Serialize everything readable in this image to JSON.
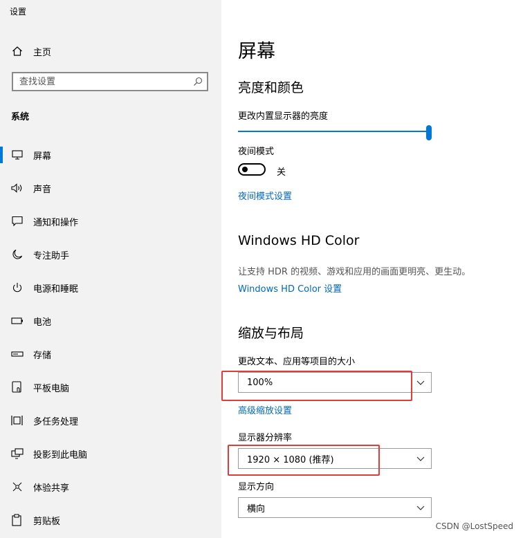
{
  "window": {
    "title": "设置"
  },
  "sidebar": {
    "home_label": "主页",
    "search_placeholder": "查找设置",
    "section_label": "系统",
    "items": [
      {
        "label": "屏幕",
        "icon": "monitor-icon"
      },
      {
        "label": "声音",
        "icon": "speaker-icon"
      },
      {
        "label": "通知和操作",
        "icon": "notification-icon"
      },
      {
        "label": "专注助手",
        "icon": "moon-icon"
      },
      {
        "label": "电源和睡眠",
        "icon": "power-icon"
      },
      {
        "label": "电池",
        "icon": "battery-icon"
      },
      {
        "label": "存储",
        "icon": "storage-icon"
      },
      {
        "label": "平板电脑",
        "icon": "tablet-icon"
      },
      {
        "label": "多任务处理",
        "icon": "multitask-icon"
      },
      {
        "label": "投影到此电脑",
        "icon": "project-icon"
      },
      {
        "label": "体验共享",
        "icon": "share-icon"
      },
      {
        "label": "剪贴板",
        "icon": "clipboard-icon"
      }
    ],
    "active_index": 0
  },
  "main": {
    "title": "屏幕",
    "brightness": {
      "heading": "亮度和颜色",
      "slider_label": "更改内置显示器的亮度",
      "slider_value_percent": 100,
      "night_mode_label": "夜间模式",
      "night_mode_state": "关",
      "night_mode_link": "夜间模式设置"
    },
    "hdr": {
      "heading": "Windows HD Color",
      "description": "让支持 HDR 的视频、游戏和应用的画面更明亮、更生动。",
      "link": "Windows HD Color 设置"
    },
    "scale": {
      "heading": "缩放与布局",
      "scale_label": "更改文本、应用等项目的大小",
      "scale_value": "100%",
      "advanced_link": "高级缩放设置",
      "resolution_label": "显示器分辨率",
      "resolution_value": "1920 × 1080 (推荐)",
      "orientation_label": "显示方向",
      "orientation_value": "横向"
    }
  },
  "watermark": "CSDN @LostSpeed",
  "colors": {
    "accent": "#0078d7",
    "link": "#0067c0",
    "highlight_box": "#e03c3c",
    "sidebar_bg": "#f2f2f2"
  }
}
